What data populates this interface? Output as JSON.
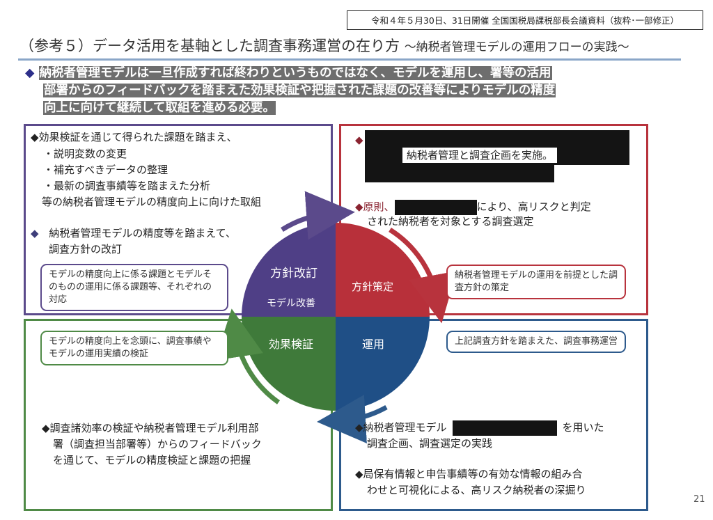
{
  "stamp": "令和４年５月30日、31日開催 全国国税局課税部長会議資料（抜粋･一部修正）",
  "title": {
    "main": "（参考５）データ活用を基軸とした調査事務運営の在り方",
    "sub": "〜納税者管理モデルの運用フローの実践〜"
  },
  "lead": {
    "bullet": "◆",
    "line1": "納税者管理モデルは一旦作成すれば終わりというものではなく、モデルを運用し、署等の活用",
    "line2": "部署からのフィードバックを踏まえた効果検証や把握された課題の改善等によりモデルの精度",
    "line3": "向上に向けて継続して取組を進める必要。"
  },
  "cycle": {
    "policy_revision": "方針改訂",
    "model_improvement": "モデル改善",
    "policy_formulation": "方針策定",
    "effect_verification": "効果検証",
    "operation": "運用"
  },
  "top_left": {
    "b1_head": "◆効果検証を通じて得られた課題を踏まえ、",
    "b1_items": [
      "・説明変数の変更",
      "・補充すべきデータの整理",
      "・最新の調査事績等を踏まえた分析"
    ],
    "b1_tail": "等の納税者管理モデルの精度向上に向けた取組",
    "b2_bullet": "◆",
    "b2_line1": "納税者管理モデルの精度等を踏まえて、",
    "b2_line2": "調査方針の改訂",
    "box": "モデルの精度向上に係る課題とモデルそのものの運用に係る課題等、それぞれの対応"
  },
  "top_right": {
    "b1_bullet": "◆",
    "b1_visible": "納税者管理と調査企画を実施。",
    "b2_a": "◆原則、",
    "b2_b": "により、高リスクと判定",
    "b2_c": "された納税者を対象とする調査選定",
    "box": "納税者管理モデルの運用を前提とした調査方針の策定"
  },
  "bottom_left": {
    "box": "モデルの精度向上を念頭に、調査事績やモデルの運用実績の検証",
    "b1": [
      "◆調査諸効率の検証や納税者管理モデル利用部",
      "署（調査担当部署等）からのフィードバック",
      "を通じて、モデルの精度検証と課題の把握"
    ]
  },
  "bottom_right": {
    "box": "上記調査方針を踏まえた、調査事務運営",
    "b1_a": "◆納税者管理モデル",
    "b1_b": "を用いた",
    "b1_c": "調査企画、調査選定の実践",
    "b2": [
      "◆局保有情報と申告事績等の有効な情報の組み合",
      "わせと可視化による、高リスク納税者の深掘り"
    ]
  },
  "page_number": "21",
  "colors": {
    "purple": "#5b4a8b",
    "red": "#b8333d",
    "green": "#4f8a46",
    "blue": "#2d5a8c"
  }
}
